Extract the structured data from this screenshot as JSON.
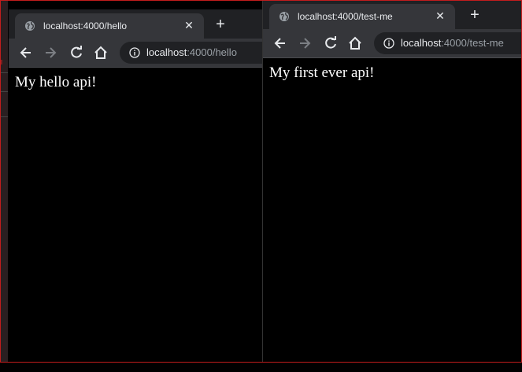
{
  "windows": [
    {
      "tab_title": "localhost:4000/hello",
      "address_host": "localhost",
      "address_path": ":4000/hello",
      "page_text": "My hello api!"
    },
    {
      "tab_title": "localhost:4000/test-me",
      "address_host": "localhost",
      "address_path": ":4000/test-me",
      "page_text": "My first ever api!"
    }
  ],
  "icons": {
    "favicon": "globe-icon",
    "close": "close-icon",
    "new_tab": "plus-icon",
    "back": "arrow-left-icon",
    "forward": "arrow-right-icon",
    "reload": "reload-icon",
    "home": "home-icon",
    "site_info": "info-icon"
  },
  "colors": {
    "border": "#c21d1d",
    "tab_active": "#35363a",
    "chrome_bg": "#202124",
    "page_bg": "#000000",
    "text": "#e8eaed"
  }
}
